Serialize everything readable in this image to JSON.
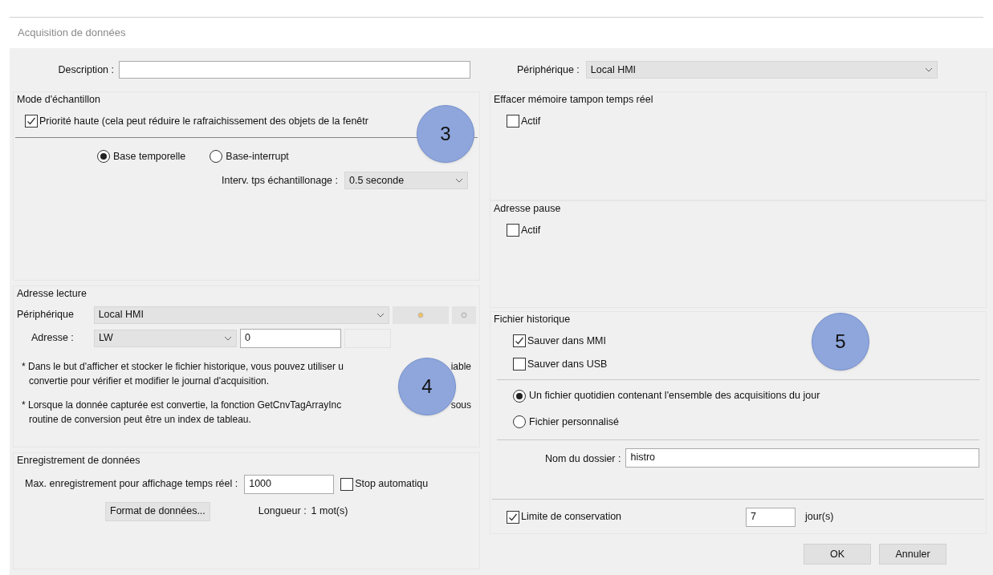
{
  "window": {
    "title": "Acquisition de données"
  },
  "description": {
    "label": "Description :"
  },
  "sample_mode": {
    "title": "Mode d'échantillon",
    "priority": {
      "label": "Priorité haute (cela peut réduire le rafraichissement des objets de la fenêtr",
      "checked": true
    },
    "bases": [
      {
        "label": "Base temporelle",
        "selected": true
      },
      {
        "label": "Base-interrupt",
        "selected": false
      }
    ],
    "interval": {
      "label": "Interv. tps échantillonage :",
      "value": "0.5 seconde"
    }
  },
  "read_address": {
    "title": "Adresse lecture",
    "device_label": "Périphérique",
    "device": "Local HMI",
    "address_label": "Adresse :",
    "address_type": "LW",
    "address_value": "0",
    "notes": [
      {
        "before": "* Dans le but d'afficher et stocker le fichier historique, vous pouvez utiliser u",
        "after": "iable",
        "rest": "convertie pour vérifier et modifier le journal d'acquisition."
      },
      {
        "before": "* Lorsque la donnée capturée est convertie, la fonction GetCnvTagArrayInc",
        "after": "sous",
        "rest": "routine de conversion peut être un index de tableau."
      }
    ]
  },
  "data_logging": {
    "title": "Enregistrement de données",
    "max_label": "Max. enregistrement pour affichage temps réel :",
    "max_value": "1000",
    "auto_stop": {
      "label": "Stop automatiqu",
      "checked": false
    },
    "format_button": "Format de données...",
    "length_label": "Longueur :",
    "length_value": "1 mot(s)"
  },
  "device": {
    "label": "Périphérique :",
    "value": "Local HMI"
  },
  "clear_buffer": {
    "title": "Effacer mémoire tampon temps réel",
    "active": {
      "label": "Actif",
      "checked": false
    }
  },
  "pause_address": {
    "title": "Adresse pause",
    "active": {
      "label": "Actif",
      "checked": false
    }
  },
  "history": {
    "title": "Fichier historique",
    "save_targets": [
      {
        "label": "Sauver dans MMI",
        "checked": true
      },
      {
        "label": "Sauver dans USB",
        "checked": false
      }
    ],
    "file_modes": [
      {
        "label": "Un fichier quotidien contenant l'ensemble des acquisitions du jour",
        "selected": true
      },
      {
        "label": "Fichier personnalisé",
        "selected": false
      }
    ],
    "folder": {
      "label": "Nom du dossier :",
      "value": "histro"
    },
    "retention": {
      "label": "Limite de conservation",
      "checked": true,
      "value": "7",
      "unit": "jour(s)"
    }
  },
  "buttons": [
    "OK",
    "Annuler"
  ],
  "markers": [
    "3",
    "4",
    "5"
  ]
}
